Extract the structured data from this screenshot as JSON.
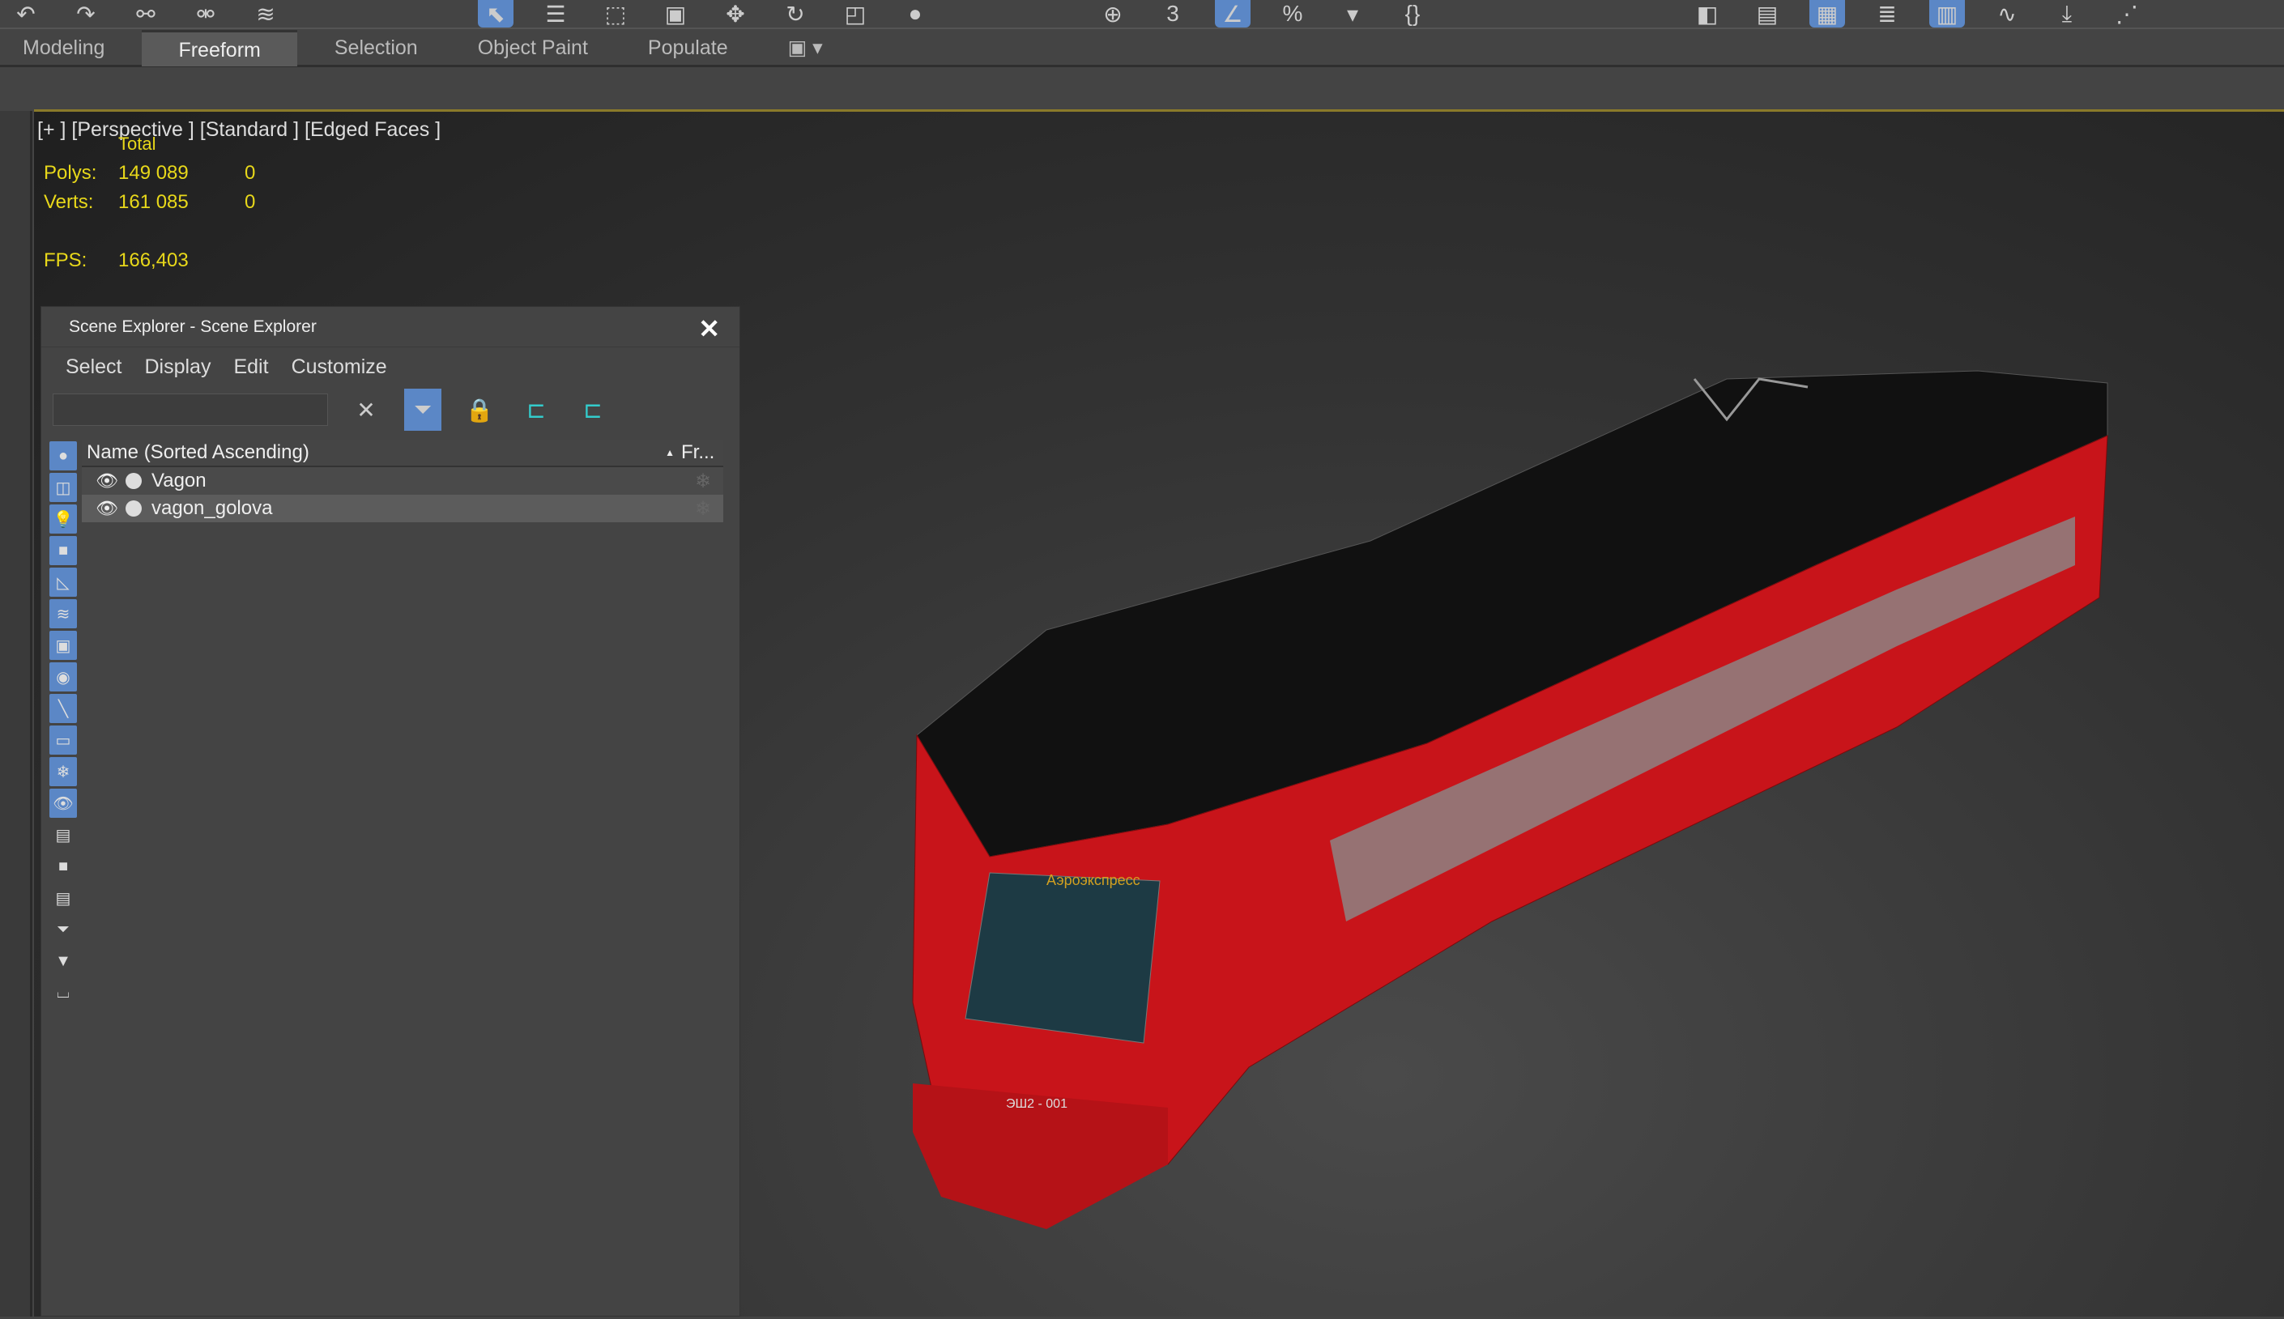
{
  "toolbar": {
    "icons": [
      "undo-icon",
      "redo-icon",
      "link-icon",
      "unlink-icon",
      "bind-spacewarp-icon",
      "select-object-icon",
      "select-by-name-icon",
      "rect-region-icon",
      "window-crossing-icon",
      "move-icon",
      "rotate-icon",
      "scale-icon",
      "placement-icon",
      "pivot-icon",
      "snap-3d-icon",
      "angle-snap-icon",
      "percent-snap-icon",
      "spinner-snap-icon",
      "named-selection-icon",
      "mirror-icon",
      "align-icon",
      "layers-icon",
      "scene-explorer-icon",
      "ribbon-icon",
      "curve-editor-icon",
      "schematic-icon",
      "material-editor-icon"
    ]
  },
  "ribbon": {
    "tabs": [
      "Modeling",
      "Freeform",
      "Selection",
      "Object Paint",
      "Populate"
    ],
    "active": "Freeform"
  },
  "viewport": {
    "label": "[+ ] [Perspective ]  [Standard ] [Edged Faces ]",
    "stats": {
      "total_label": "Total",
      "polys_label": "Polys:",
      "polys_total": "149 089",
      "polys_sel": "0",
      "verts_label": "Verts:",
      "verts_total": "161 085",
      "verts_sel": "0",
      "fps_label": "FPS:",
      "fps": "166,403"
    },
    "train_label": "Аэроэкспресс",
    "train_number": "ЭШ2 - 001"
  },
  "explorer": {
    "title": "Scene Explorer - Scene Explorer",
    "close": "✕",
    "menu": [
      "Select",
      "Display",
      "Edit",
      "Customize"
    ],
    "search_value": "",
    "column_name": "Name (Sorted Ascending)",
    "column_frozen": "Fr...",
    "rows": [
      {
        "name": "Vagon"
      },
      {
        "name": "vagon_golova"
      }
    ]
  },
  "colors": {
    "accent": "#5b87c6",
    "stats": "#e8d81a",
    "train_red": "#c8141a"
  }
}
